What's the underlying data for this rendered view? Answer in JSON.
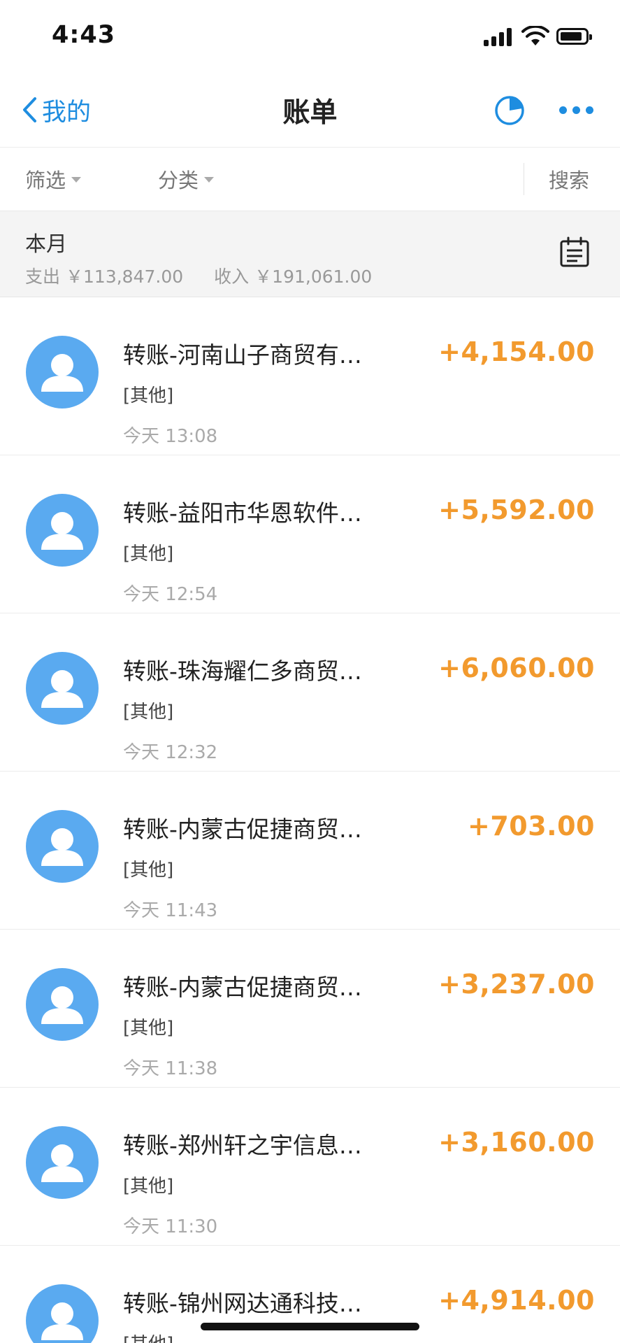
{
  "status_bar": {
    "time": "4:43"
  },
  "nav": {
    "back_label": "我的",
    "title": "账单",
    "chart_icon": "pie-chart-icon",
    "more_icon": "more-dots-icon"
  },
  "filters": {
    "filter_label": "筛选",
    "category_label": "分类",
    "search_label": "搜索"
  },
  "summary": {
    "month": "本月",
    "expense_label": "支出",
    "expense_value": "￥113,847.00",
    "income_label": "收入",
    "income_value": "￥191,061.00",
    "calendar_icon": "calendar-icon"
  },
  "colors": {
    "accent": "#1e8de0",
    "amount": "#f29a2e",
    "avatar": "#5aaaf0"
  },
  "transactions": [
    {
      "title": "转账-河南山子商贸有…",
      "category": "[其他]",
      "date": "今天",
      "time": "13:08",
      "amount": "+4,154.00"
    },
    {
      "title": "转账-益阳市华恩软件…",
      "category": "[其他]",
      "date": "今天",
      "time": "12:54",
      "amount": "+5,592.00"
    },
    {
      "title": "转账-珠海耀仁多商贸…",
      "category": "[其他]",
      "date": "今天",
      "time": "12:32",
      "amount": "+6,060.00"
    },
    {
      "title": "转账-内蒙古促捷商贸…",
      "category": "[其他]",
      "date": "今天",
      "time": "11:43",
      "amount": "+703.00"
    },
    {
      "title": "转账-内蒙古促捷商贸…",
      "category": "[其他]",
      "date": "今天",
      "time": "11:38",
      "amount": "+3,237.00"
    },
    {
      "title": "转账-郑州轩之宇信息…",
      "category": "[其他]",
      "date": "今天",
      "time": "11:30",
      "amount": "+3,160.00"
    },
    {
      "title": "转账-锦州网达通科技…",
      "category": "[其他]",
      "date": "",
      "time": "",
      "amount": "+4,914.00"
    }
  ]
}
